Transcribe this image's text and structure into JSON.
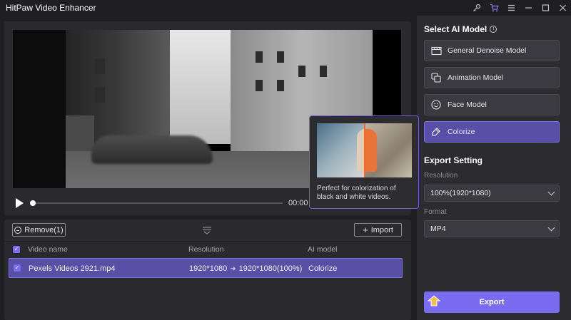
{
  "app": {
    "title": "HitPaw Video Enhancer"
  },
  "titlebar": {
    "icons": [
      "key-icon",
      "cart-icon",
      "menu-icon",
      "minimize-icon",
      "maximize-icon",
      "close-icon"
    ]
  },
  "player": {
    "time": "00:00 / 0"
  },
  "tooltip": {
    "description": "Perfect for colorization of black and white videos."
  },
  "list": {
    "remove_label": "Remove(1)",
    "import_label": "Import",
    "headers": {
      "name": "Video name",
      "resolution": "Resolution",
      "ai_model": "AI model"
    },
    "rows": [
      {
        "name": "Pexels Videos 2921.mp4",
        "res_from": "1920*1080",
        "res_to": "1920*1080(100%)",
        "ai_model": "Colorize"
      }
    ]
  },
  "ai_panel": {
    "title": "Select AI Model",
    "models": [
      {
        "label": "General Denoise Model",
        "icon": "film-icon",
        "active": false
      },
      {
        "label": "Animation Model",
        "icon": "animation-icon",
        "active": false
      },
      {
        "label": "Face Model",
        "icon": "face-icon",
        "active": false
      },
      {
        "label": "Colorize",
        "icon": "brush-icon",
        "active": true
      }
    ]
  },
  "export": {
    "title": "Export Setting",
    "resolution_label": "Resolution",
    "resolution_value": "100%(1920*1080)",
    "format_label": "Format",
    "format_value": "MP4",
    "button_label": "Export"
  },
  "colors": {
    "accent": "#7a6cf0",
    "selected_row": "#5a4fa6",
    "panel": "#2c2c30"
  }
}
